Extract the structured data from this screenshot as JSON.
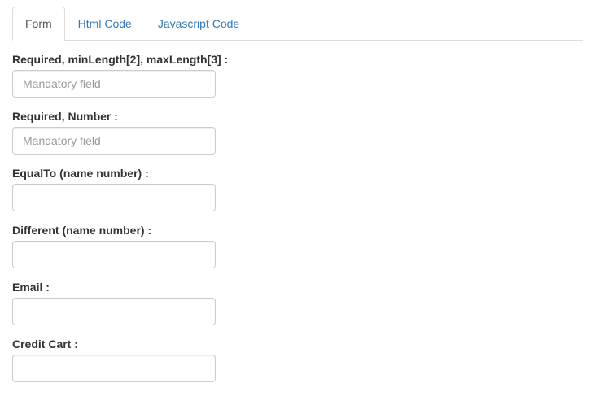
{
  "tabs": [
    {
      "label": "Form",
      "active": true
    },
    {
      "label": "Html Code",
      "active": false
    },
    {
      "label": "Javascript Code",
      "active": false
    }
  ],
  "fields": [
    {
      "label": "Required, minLength[2], maxLength[3] :",
      "placeholder": "Mandatory field",
      "name": "required-minmax"
    },
    {
      "label": "Required, Number :",
      "placeholder": "Mandatory field",
      "name": "required-number"
    },
    {
      "label": "EqualTo (name number) :",
      "placeholder": "",
      "name": "equalto"
    },
    {
      "label": "Different (name number) :",
      "placeholder": "",
      "name": "different"
    },
    {
      "label": "Email :",
      "placeholder": "",
      "name": "email"
    },
    {
      "label": "Credit Cart :",
      "placeholder": "",
      "name": "creditcard"
    }
  ]
}
